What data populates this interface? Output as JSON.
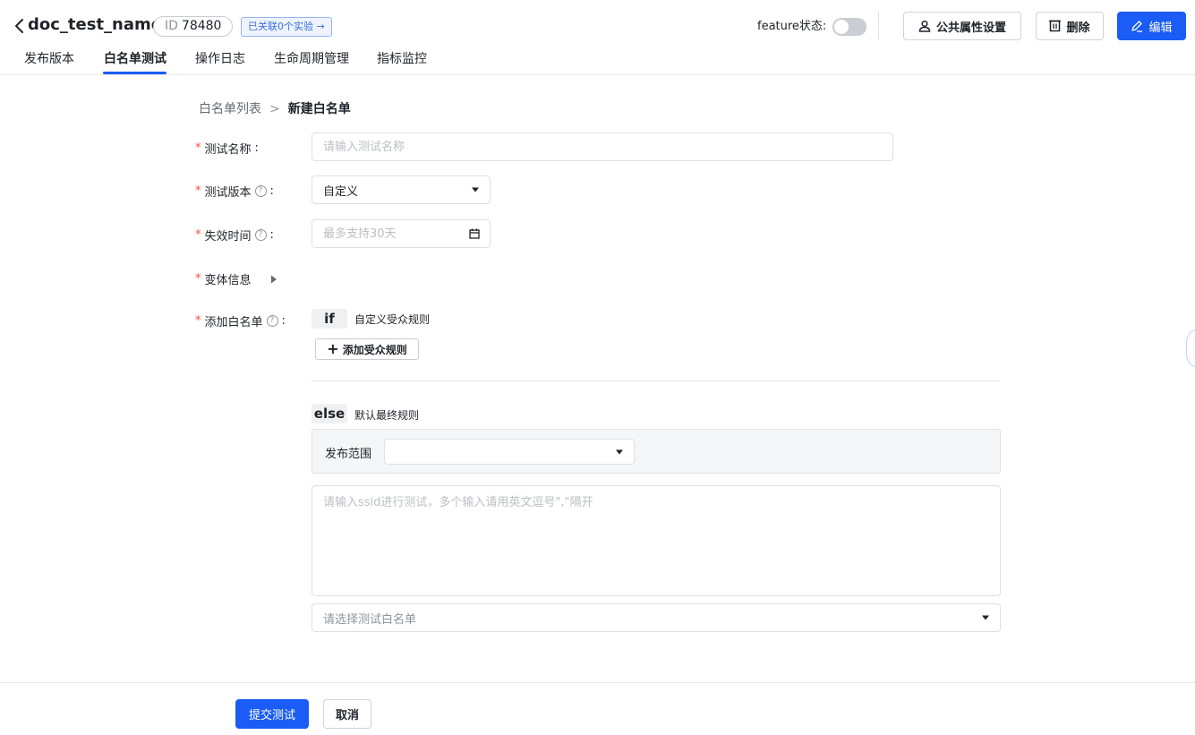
{
  "header": {
    "back_icon": "chevron-left-icon",
    "title": "doc_test_name",
    "id_prefix": "ID",
    "id_value": "78480",
    "linked_tag": "已关联0个实验 →",
    "feature_status_label": "feature状态:",
    "feature_enabled": false,
    "public_settings_label": "公共属性设置",
    "delete_label": "删除",
    "edit_label": "编辑",
    "accent_color": "#1a5cf5"
  },
  "tabs": [
    {
      "label": "发布版本",
      "active": false
    },
    {
      "label": "白名单测试",
      "active": true
    },
    {
      "label": "操作日志",
      "active": false
    },
    {
      "label": "生命周期管理",
      "active": false
    },
    {
      "label": "指标监控",
      "active": false
    }
  ],
  "breadcrumb": {
    "parent": "白名单列表",
    "separator": ">",
    "current": "新建白名单"
  },
  "form": {
    "required_mark": "*",
    "test_name": {
      "label": "测试名称",
      "placeholder": "请输入测试名称",
      "value": ""
    },
    "test_version": {
      "label": "测试版本",
      "value": "自定义"
    },
    "expire_time": {
      "label": "失效时间",
      "placeholder": "最多支持30天"
    },
    "variant_info": {
      "label": "变体信息"
    },
    "add_whitelist": {
      "label": "添加白名单"
    },
    "if_tag": "if",
    "if_desc": "自定义受众规则",
    "add_rule_label": "添加受众规则",
    "else_tag": "else",
    "else_desc": "默认最终规则",
    "release_range_label": "发布范围",
    "release_range_value": "",
    "ssid_placeholder": "请输入ssid进行测试，多个输入请用英文逗号\",\"隔开",
    "whitelist_select_placeholder": "请选择测试白名单"
  },
  "footer": {
    "submit_label": "提交测试",
    "cancel_label": "取消"
  }
}
